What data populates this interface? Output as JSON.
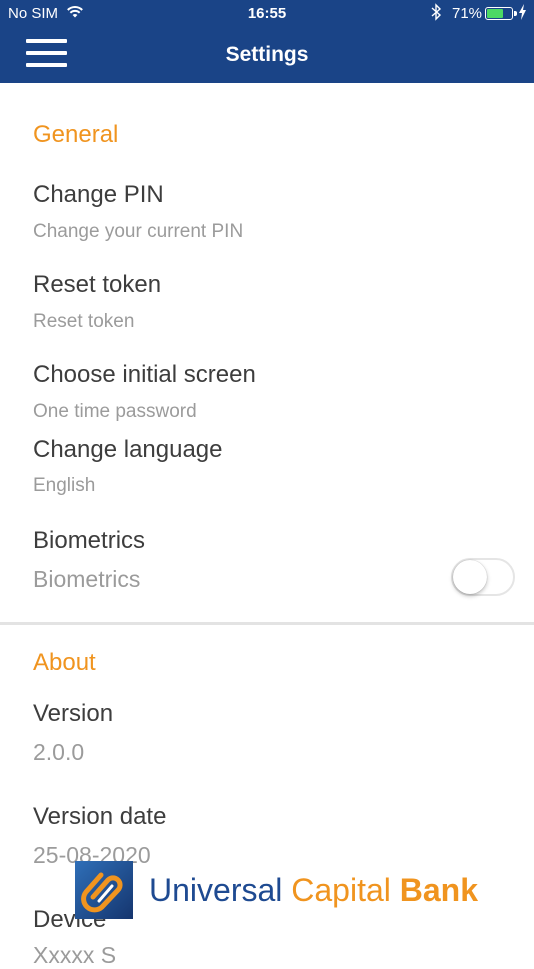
{
  "status_bar": {
    "carrier": "No SIM",
    "time": "16:55",
    "battery_percent": "71%",
    "battery_level": 0.71,
    "battery_color": "#4cd964"
  },
  "header": {
    "title": "Settings",
    "menu_icon": "hamburger-menu-icon",
    "background": "#1a4487"
  },
  "general": {
    "heading": "General",
    "items": [
      {
        "title": "Change PIN",
        "subtitle": "Change your current PIN"
      },
      {
        "title": "Reset token",
        "subtitle": "Reset token"
      },
      {
        "title": "Choose initial screen",
        "subtitle": "One time password"
      },
      {
        "title": "Change language",
        "subtitle": "English"
      }
    ],
    "biometrics": {
      "title": "Biometrics",
      "subtitle": "Biometrics",
      "enabled": false
    }
  },
  "about": {
    "heading": "About",
    "version_label": "Version",
    "version_value": "2.0.0",
    "version_date_label": "Version date",
    "version_date_value": "25-08-2020",
    "device_label": "Device",
    "device_value": "Xxxxx S"
  },
  "brand": {
    "word1": "Universal",
    "word2": "Capital",
    "word3": "Bank",
    "primary_color": "#1e4a91",
    "accent_color": "#f0941f"
  }
}
